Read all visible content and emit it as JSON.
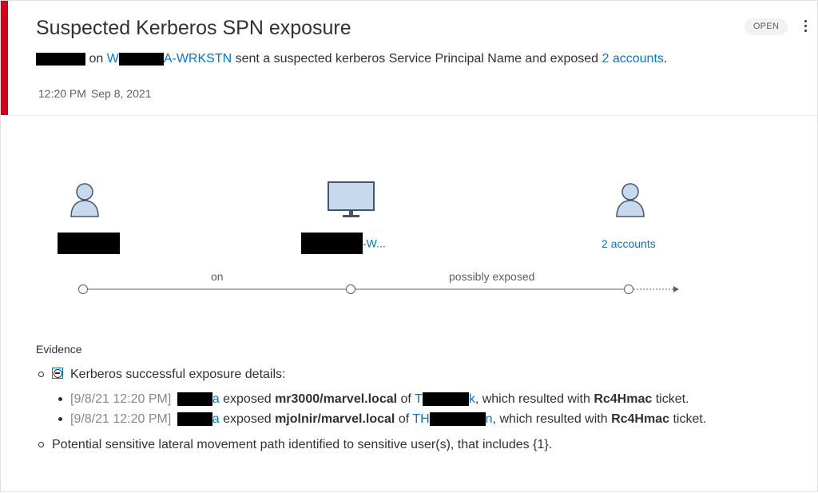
{
  "alert": {
    "title": "Suspected Kerberos SPN exposure",
    "status": "OPEN",
    "subtitle": {
      "on": "on",
      "computer_prefix": "W",
      "computer_suffix": "A-WRKSTN",
      "middle": "sent a suspected kerberos Service Principal Name and exposed",
      "accounts_link": "2 accounts",
      "end": "."
    },
    "time": "12:20 PM",
    "date": "Sep 8, 2021"
  },
  "graph": {
    "source_node": {
      "icon": "user-icon"
    },
    "computer_node": {
      "icon": "monitor-icon",
      "label_suffix": "-W..."
    },
    "target_node": {
      "icon": "user-icon",
      "label": "2 accounts"
    },
    "edge_1_label": "on",
    "edge_2_label": "possibly exposed"
  },
  "evidence": {
    "title": "Evidence",
    "group_label": "Kerberos successful exposure details:",
    "items": [
      {
        "timestamp": "[9/8/21 12:20 PM]",
        "user_tail": "a",
        "verb": "exposed",
        "spn": "mr3000/marvel.local",
        "of": "of",
        "target_head": "T",
        "target_tail": "k",
        "tail": ", which resulted with",
        "ticket": "Rc4Hmac",
        "ticket_word": "ticket."
      },
      {
        "timestamp": "[9/8/21 12:20 PM]",
        "user_tail": "a",
        "verb": "exposed",
        "spn": "mjolnir/marvel.local",
        "of": "of",
        "target_head": "TH",
        "target_tail": "n",
        "tail": ", which resulted with",
        "ticket": "Rc4Hmac",
        "ticket_word": "ticket."
      }
    ],
    "lateral_text": "Potential sensitive lateral movement path identified to sensitive user(s), that includes {1}."
  },
  "colors": {
    "accent": "#d9001b",
    "link": "#0078d4",
    "icon_fill": "#c7d9ec",
    "icon_stroke": "#44546a"
  }
}
